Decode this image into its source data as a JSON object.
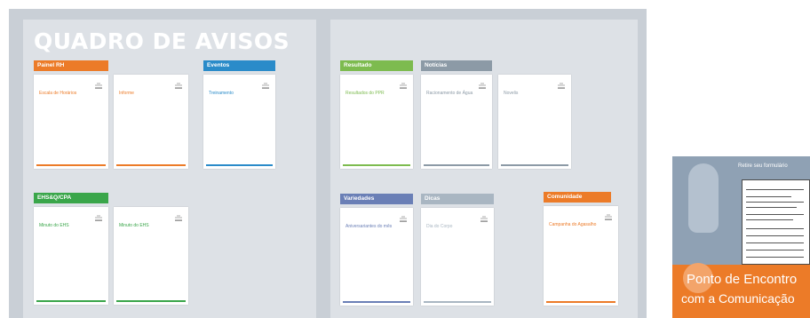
{
  "board": {
    "title": "QUADRO DE AVISOS",
    "logo": "Novelis"
  },
  "tabs": [
    {
      "key": "painel",
      "label": "Painel RH",
      "color": "#ec7b28"
    },
    {
      "key": "eventos",
      "label": "Eventos",
      "color": "#2a8bc9"
    },
    {
      "key": "ehs",
      "label": "EHS&Q/CPA",
      "color": "#3aa64a"
    },
    {
      "key": "resultado",
      "label": "Resultado",
      "color": "#7dbb4f"
    },
    {
      "key": "noticias",
      "label": "Notícias",
      "color": "#8c9aa6"
    },
    {
      "key": "variedades",
      "label": "Variedades",
      "color": "#6a7fb6"
    },
    {
      "key": "dicas",
      "label": "Dicas",
      "color": "#a9b6c2"
    },
    {
      "key": "comunidade",
      "label": "Comunidade",
      "color": "#ec7b28"
    }
  ],
  "sheets": [
    {
      "key": "s1",
      "doc": "Escala de Horários",
      "color": "#ec7b28"
    },
    {
      "key": "s2",
      "doc": "Informe",
      "color": "#ec7b28"
    },
    {
      "key": "s3",
      "doc": "Treinamento",
      "color": "#2a8bc9"
    },
    {
      "key": "s4",
      "doc": "Minuto do EHS",
      "color": "#3aa64a"
    },
    {
      "key": "s5",
      "doc": "Minuto do EHS",
      "color": "#3aa64a"
    },
    {
      "key": "s6",
      "doc": "Resultados do PPR",
      "color": "#7dbb4f"
    },
    {
      "key": "s7",
      "doc": "Racionamento de Água",
      "color": "#8c9aa6"
    },
    {
      "key": "s8",
      "doc": "Novelis",
      "color": "#8c9aa6"
    },
    {
      "key": "s9",
      "doc": "Aniversariantes do mês",
      "color": "#6a7fb6"
    },
    {
      "key": "s10",
      "doc": "Dia do Corpo",
      "color": "#a9b6c2"
    },
    {
      "key": "s11",
      "doc": "Campanha do Agasalho",
      "color": "#ec7b28"
    }
  ],
  "stand": {
    "retire": "Retire seu formulário",
    "line1": "Ponto de Encontro",
    "line2": "com a Comunicação"
  }
}
